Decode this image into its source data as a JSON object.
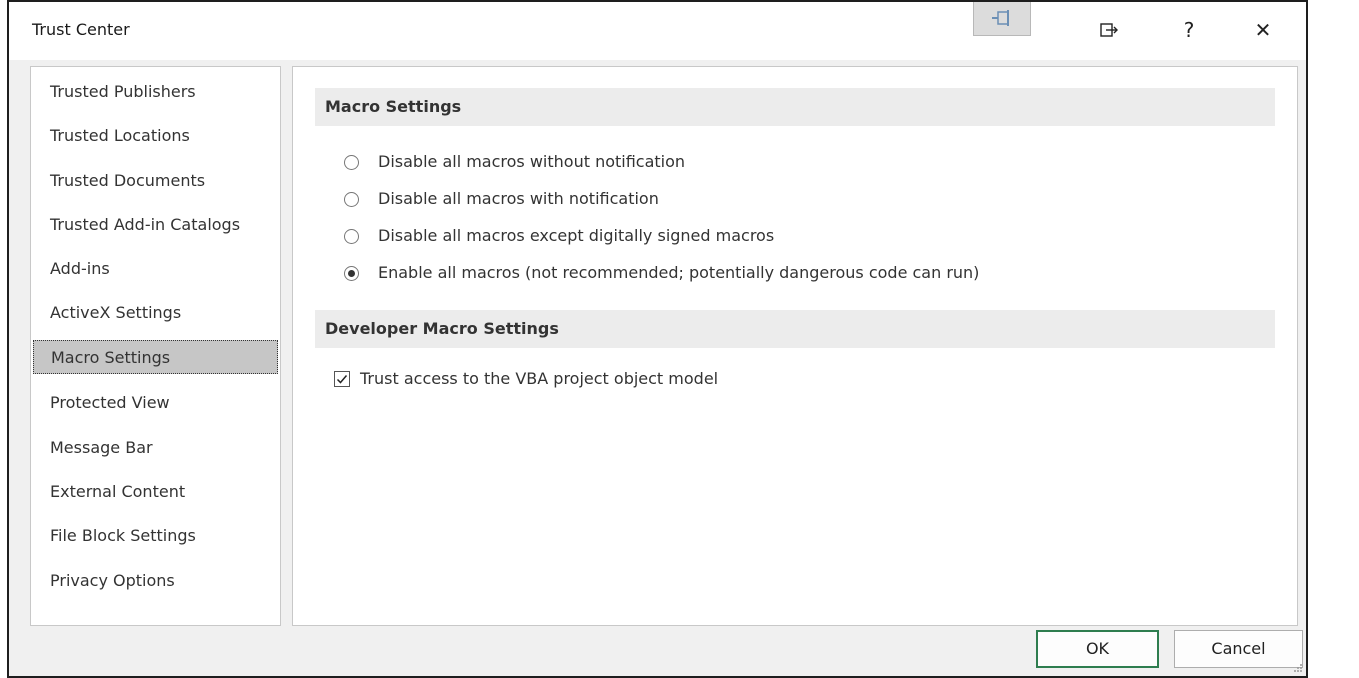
{
  "window": {
    "title": "Trust Center",
    "help_glyph": "?",
    "close_glyph": "✕"
  },
  "nav": {
    "items": [
      {
        "label": "Trusted Publishers"
      },
      {
        "label": "Trusted Locations"
      },
      {
        "label": "Trusted Documents"
      },
      {
        "label": "Trusted Add-in Catalogs"
      },
      {
        "label": "Add-ins"
      },
      {
        "label": "ActiveX Settings"
      },
      {
        "label": "Macro Settings",
        "selected": true
      },
      {
        "label": "Protected View"
      },
      {
        "label": "Message Bar"
      },
      {
        "label": "External Content"
      },
      {
        "label": "File Block Settings"
      },
      {
        "label": "Privacy Options"
      }
    ]
  },
  "macro_settings": {
    "header": "Macro Settings",
    "options": [
      {
        "label": "Disable all macros without notification",
        "selected": false
      },
      {
        "label": "Disable all macros with notification",
        "selected": false
      },
      {
        "label": "Disable all macros except digitally signed macros",
        "selected": false
      },
      {
        "label": "Enable all macros (not recommended; potentially dangerous code can run)",
        "selected": true
      }
    ]
  },
  "developer": {
    "header": "Developer Macro Settings",
    "trust_vba_label": "Trust access to the VBA project object model",
    "trust_vba_checked": true
  },
  "buttons": {
    "ok": "OK",
    "cancel": "Cancel"
  },
  "icons": {
    "pin": "pin-icon",
    "popout": "popout-icon",
    "help": "help-icon",
    "close": "close-icon"
  }
}
